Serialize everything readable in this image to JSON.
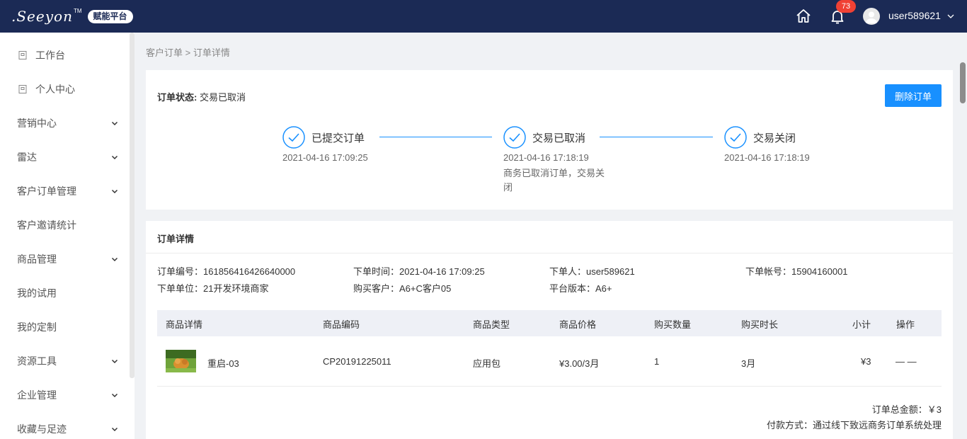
{
  "header": {
    "logo_text": ".Seeyon",
    "logo_tm": "TM",
    "platform_badge": "赋能平台",
    "notification_count": "73",
    "username": "user589621",
    "icons": [
      "home-icon",
      "bell-icon",
      "avatar",
      "chevron-down-icon"
    ]
  },
  "sidebar": {
    "items": [
      {
        "label": "工作台",
        "has_icon": true,
        "has_chevron": false
      },
      {
        "label": "个人中心",
        "has_icon": true,
        "has_chevron": false
      },
      {
        "label": "营销中心",
        "has_icon": false,
        "has_chevron": true
      },
      {
        "label": "雷达",
        "has_icon": false,
        "has_chevron": true
      },
      {
        "label": "客户订单管理",
        "has_icon": false,
        "has_chevron": true
      },
      {
        "label": "客户邀请统计",
        "has_icon": false,
        "has_chevron": false
      },
      {
        "label": "商品管理",
        "has_icon": false,
        "has_chevron": true
      },
      {
        "label": "我的试用",
        "has_icon": false,
        "has_chevron": false
      },
      {
        "label": "我的定制",
        "has_icon": false,
        "has_chevron": false
      },
      {
        "label": "资源工具",
        "has_icon": false,
        "has_chevron": true
      },
      {
        "label": "企业管理",
        "has_icon": false,
        "has_chevron": true
      },
      {
        "label": "收藏与足迹",
        "has_icon": false,
        "has_chevron": true
      }
    ]
  },
  "breadcrumb": "客户订单 > 订单详情",
  "status": {
    "label": "订单状态:",
    "value": "交易已取消",
    "delete_button": "删除订单",
    "steps": [
      {
        "title": "已提交订单",
        "time": "2021-04-16 17:09:25",
        "desc": ""
      },
      {
        "title": "交易已取消",
        "time": "2021-04-16 17:18:19",
        "desc": "商务已取消订单，交易关闭"
      },
      {
        "title": "交易关闭",
        "time": "2021-04-16 17:18:19",
        "desc": ""
      }
    ]
  },
  "detail": {
    "title": "订单详情",
    "info": {
      "order_no": "订单编号：161856416426640000",
      "order_time": "下单时间：2021-04-16 17:09:25",
      "orderer": "下单人：user589621",
      "account": "下单帐号：15904160001",
      "unit": "下单单位：21开发环境商家",
      "customer": "购买客户：A6+C客户05",
      "version": "平台版本：A6+"
    },
    "table": {
      "headers": [
        "商品详情",
        "商品编码",
        "商品类型",
        "商品价格",
        "购买数量",
        "购买时长",
        "小计",
        "操作"
      ],
      "rows": [
        {
          "name": "重启-03",
          "code": "CP20191225011",
          "type": "应用包",
          "price": "¥3.00/3月",
          "qty": "1",
          "duration": "3月",
          "subtotal": "¥3",
          "action": "— —"
        }
      ]
    },
    "total": "订单总金额：￥3",
    "payment": "付款方式：通过线下致远商务订单系统处理"
  },
  "colors": {
    "header_bg": "#1b2a55",
    "accent": "#1890ff",
    "badge": "#f04134"
  }
}
